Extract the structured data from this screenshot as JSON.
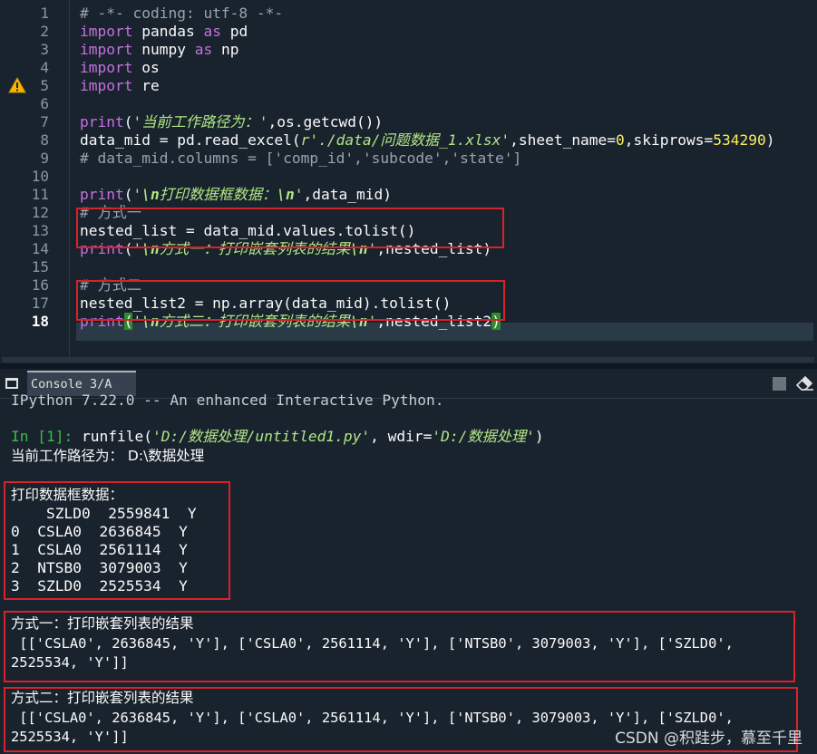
{
  "editor": {
    "line_numbers": [
      "1",
      "2",
      "3",
      "4",
      "5",
      "6",
      "7",
      "8",
      "9",
      "10",
      "11",
      "12",
      "13",
      "14",
      "15",
      "16",
      "17",
      "18"
    ],
    "current_line": "18",
    "warning_line": "5",
    "lines": [
      {
        "num": "1",
        "parts": [
          [
            "com",
            "# -*- coding: utf-8 -*-"
          ]
        ]
      },
      {
        "num": "2",
        "parts": [
          [
            "kw",
            "import"
          ],
          [
            "txt",
            " pandas "
          ],
          [
            "kw",
            "as"
          ],
          [
            "txt",
            " pd"
          ]
        ]
      },
      {
        "num": "3",
        "parts": [
          [
            "kw",
            "import"
          ],
          [
            "txt",
            " numpy "
          ],
          [
            "kw",
            "as"
          ],
          [
            "txt",
            " np"
          ]
        ]
      },
      {
        "num": "4",
        "parts": [
          [
            "kw",
            "import"
          ],
          [
            "txt",
            " os"
          ]
        ]
      },
      {
        "num": "5",
        "parts": [
          [
            "kw",
            "import"
          ],
          [
            "txt",
            " re"
          ]
        ]
      },
      {
        "num": "6",
        "parts": []
      },
      {
        "num": "7",
        "parts": [
          [
            "fn",
            "print"
          ],
          [
            "txt",
            "("
          ],
          [
            "str",
            "'当前工作路径为：'"
          ],
          [
            "txt",
            ",os.getcwd())"
          ]
        ]
      },
      {
        "num": "8",
        "parts": [
          [
            "txt",
            "data_mid = pd.read_excel("
          ],
          [
            "str",
            "r'./data/问题数据_1.xlsx'"
          ],
          [
            "txt",
            ",sheet_name="
          ],
          [
            "num",
            "0"
          ],
          [
            "txt",
            ",skiprows="
          ],
          [
            "num",
            "534290"
          ],
          [
            "txt",
            ")"
          ]
        ]
      },
      {
        "num": "9",
        "parts": [
          [
            "com",
            "# data_mid.columns = ['comp_id','subcode','state']"
          ]
        ]
      },
      {
        "num": "10",
        "parts": []
      },
      {
        "num": "11",
        "parts": [
          [
            "fn",
            "print"
          ],
          [
            "txt",
            "("
          ],
          [
            "str",
            "'"
          ],
          [
            "esc",
            "\\n"
          ],
          [
            "str",
            "打印数据框数据："
          ],
          [
            "esc",
            "\\n"
          ],
          [
            "str",
            "'"
          ],
          [
            "txt",
            ",data_mid)"
          ]
        ]
      },
      {
        "num": "12",
        "parts": [
          [
            "com",
            "# 方式一"
          ]
        ]
      },
      {
        "num": "13",
        "parts": [
          [
            "txt",
            "nested_list = data_mid.values.tolist()"
          ]
        ]
      },
      {
        "num": "14",
        "parts": [
          [
            "fn",
            "print"
          ],
          [
            "txt",
            "("
          ],
          [
            "str",
            "'"
          ],
          [
            "esc",
            "\\n"
          ],
          [
            "str",
            "方式一：打印嵌套列表的结果"
          ],
          [
            "esc",
            "\\n"
          ],
          [
            "str",
            "'"
          ],
          [
            "txt",
            ",nested_list)"
          ]
        ]
      },
      {
        "num": "15",
        "parts": []
      },
      {
        "num": "16",
        "parts": [
          [
            "com",
            "# 方式二"
          ]
        ]
      },
      {
        "num": "17",
        "parts": [
          [
            "txt",
            "nested_list2 = np.array(data_mid).tolist()"
          ]
        ]
      },
      {
        "num": "18",
        "parts": [
          [
            "fn",
            "print"
          ],
          [
            "bm",
            "("
          ],
          [
            "str",
            "'"
          ],
          [
            "esc",
            "\\n"
          ],
          [
            "str",
            "方式二：打印嵌套列表的结果"
          ],
          [
            "esc",
            "\\n"
          ],
          [
            "str",
            "'"
          ],
          [
            "txt",
            ",nested_list2"
          ],
          [
            "bm",
            ")"
          ]
        ]
      }
    ]
  },
  "console_pane": {
    "tab_label": "Console 3/A",
    "partial_header": "IPython 7.22.0 -- An enhanced Interactive Python.",
    "prompt": "In [1]:",
    "runfile_call": " runfile(",
    "runfile_arg1": "'D:/数据处理/untitled1.py'",
    "runfile_mid": ", wdir=",
    "runfile_arg2": "'D:/数据处理'",
    "runfile_end": ")",
    "cwd_line": "当前工作路径为： D:\\数据处理",
    "df_title": "打印数据框数据：",
    "df_header": "    SZLD0  2559841  Y",
    "df_rows": [
      "0  CSLA0  2636845  Y",
      "1  CSLA0  2561114  Y",
      "2  NTSB0  3079003  Y",
      "3  SZLD0  2525534  Y"
    ],
    "m1_title": "方式一：打印嵌套列表的结果",
    "m1_line1": " [['CSLA0', 2636845, 'Y'], ['CSLA0', 2561114, 'Y'], ['NTSB0', 3079003, 'Y'], ['SZLD0',",
    "m1_line2": "2525534, 'Y']]",
    "m2_title": "方式二：打印嵌套列表的结果",
    "m2_line1": " [['CSLA0', 2636845, 'Y'], ['CSLA0', 2561114, 'Y'], ['NTSB0', 3079003, 'Y'], ['SZLD0',",
    "m2_line2": "2525534, 'Y']]"
  },
  "watermark": "CSDN @积跬步，慕至千里",
  "colors": {
    "background": "#19232d",
    "highlight_box": "#d9212b",
    "keyword": "#c670e0",
    "string": "#b0e686",
    "number": "#faed5c",
    "prompt": "#3dba4a"
  },
  "icons": [
    "warning-icon",
    "console-tab-icon",
    "stop-icon",
    "eraser-icon"
  ]
}
